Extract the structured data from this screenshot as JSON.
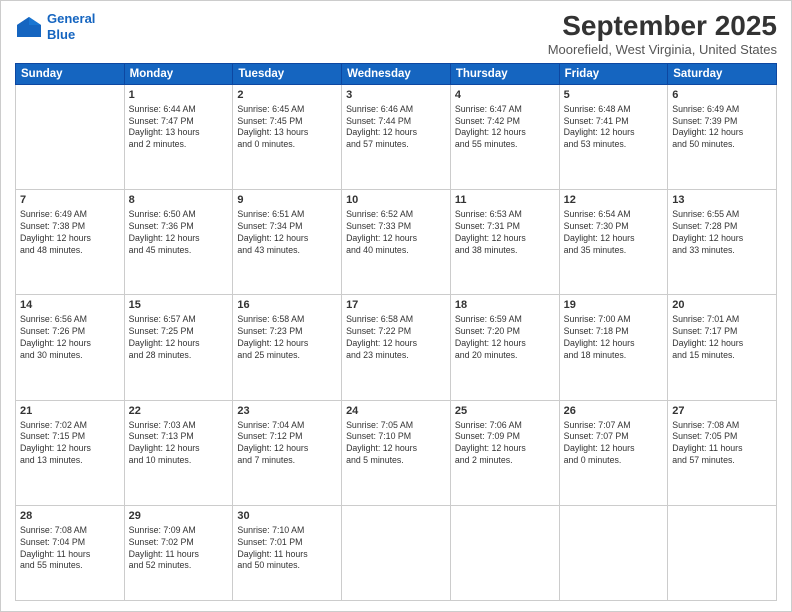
{
  "logo": {
    "line1": "General",
    "line2": "Blue"
  },
  "header": {
    "month_title": "September 2025",
    "location": "Moorefield, West Virginia, United States"
  },
  "days_of_week": [
    "Sunday",
    "Monday",
    "Tuesday",
    "Wednesday",
    "Thursday",
    "Friday",
    "Saturday"
  ],
  "weeks": [
    [
      {
        "day": "",
        "info": ""
      },
      {
        "day": "1",
        "info": "Sunrise: 6:44 AM\nSunset: 7:47 PM\nDaylight: 13 hours\nand 2 minutes."
      },
      {
        "day": "2",
        "info": "Sunrise: 6:45 AM\nSunset: 7:45 PM\nDaylight: 13 hours\nand 0 minutes."
      },
      {
        "day": "3",
        "info": "Sunrise: 6:46 AM\nSunset: 7:44 PM\nDaylight: 12 hours\nand 57 minutes."
      },
      {
        "day": "4",
        "info": "Sunrise: 6:47 AM\nSunset: 7:42 PM\nDaylight: 12 hours\nand 55 minutes."
      },
      {
        "day": "5",
        "info": "Sunrise: 6:48 AM\nSunset: 7:41 PM\nDaylight: 12 hours\nand 53 minutes."
      },
      {
        "day": "6",
        "info": "Sunrise: 6:49 AM\nSunset: 7:39 PM\nDaylight: 12 hours\nand 50 minutes."
      }
    ],
    [
      {
        "day": "7",
        "info": "Sunrise: 6:49 AM\nSunset: 7:38 PM\nDaylight: 12 hours\nand 48 minutes."
      },
      {
        "day": "8",
        "info": "Sunrise: 6:50 AM\nSunset: 7:36 PM\nDaylight: 12 hours\nand 45 minutes."
      },
      {
        "day": "9",
        "info": "Sunrise: 6:51 AM\nSunset: 7:34 PM\nDaylight: 12 hours\nand 43 minutes."
      },
      {
        "day": "10",
        "info": "Sunrise: 6:52 AM\nSunset: 7:33 PM\nDaylight: 12 hours\nand 40 minutes."
      },
      {
        "day": "11",
        "info": "Sunrise: 6:53 AM\nSunset: 7:31 PM\nDaylight: 12 hours\nand 38 minutes."
      },
      {
        "day": "12",
        "info": "Sunrise: 6:54 AM\nSunset: 7:30 PM\nDaylight: 12 hours\nand 35 minutes."
      },
      {
        "day": "13",
        "info": "Sunrise: 6:55 AM\nSunset: 7:28 PM\nDaylight: 12 hours\nand 33 minutes."
      }
    ],
    [
      {
        "day": "14",
        "info": "Sunrise: 6:56 AM\nSunset: 7:26 PM\nDaylight: 12 hours\nand 30 minutes."
      },
      {
        "day": "15",
        "info": "Sunrise: 6:57 AM\nSunset: 7:25 PM\nDaylight: 12 hours\nand 28 minutes."
      },
      {
        "day": "16",
        "info": "Sunrise: 6:58 AM\nSunset: 7:23 PM\nDaylight: 12 hours\nand 25 minutes."
      },
      {
        "day": "17",
        "info": "Sunrise: 6:58 AM\nSunset: 7:22 PM\nDaylight: 12 hours\nand 23 minutes."
      },
      {
        "day": "18",
        "info": "Sunrise: 6:59 AM\nSunset: 7:20 PM\nDaylight: 12 hours\nand 20 minutes."
      },
      {
        "day": "19",
        "info": "Sunrise: 7:00 AM\nSunset: 7:18 PM\nDaylight: 12 hours\nand 18 minutes."
      },
      {
        "day": "20",
        "info": "Sunrise: 7:01 AM\nSunset: 7:17 PM\nDaylight: 12 hours\nand 15 minutes."
      }
    ],
    [
      {
        "day": "21",
        "info": "Sunrise: 7:02 AM\nSunset: 7:15 PM\nDaylight: 12 hours\nand 13 minutes."
      },
      {
        "day": "22",
        "info": "Sunrise: 7:03 AM\nSunset: 7:13 PM\nDaylight: 12 hours\nand 10 minutes."
      },
      {
        "day": "23",
        "info": "Sunrise: 7:04 AM\nSunset: 7:12 PM\nDaylight: 12 hours\nand 7 minutes."
      },
      {
        "day": "24",
        "info": "Sunrise: 7:05 AM\nSunset: 7:10 PM\nDaylight: 12 hours\nand 5 minutes."
      },
      {
        "day": "25",
        "info": "Sunrise: 7:06 AM\nSunset: 7:09 PM\nDaylight: 12 hours\nand 2 minutes."
      },
      {
        "day": "26",
        "info": "Sunrise: 7:07 AM\nSunset: 7:07 PM\nDaylight: 12 hours\nand 0 minutes."
      },
      {
        "day": "27",
        "info": "Sunrise: 7:08 AM\nSunset: 7:05 PM\nDaylight: 11 hours\nand 57 minutes."
      }
    ],
    [
      {
        "day": "28",
        "info": "Sunrise: 7:08 AM\nSunset: 7:04 PM\nDaylight: 11 hours\nand 55 minutes."
      },
      {
        "day": "29",
        "info": "Sunrise: 7:09 AM\nSunset: 7:02 PM\nDaylight: 11 hours\nand 52 minutes."
      },
      {
        "day": "30",
        "info": "Sunrise: 7:10 AM\nSunset: 7:01 PM\nDaylight: 11 hours\nand 50 minutes."
      },
      {
        "day": "",
        "info": ""
      },
      {
        "day": "",
        "info": ""
      },
      {
        "day": "",
        "info": ""
      },
      {
        "day": "",
        "info": ""
      }
    ]
  ]
}
